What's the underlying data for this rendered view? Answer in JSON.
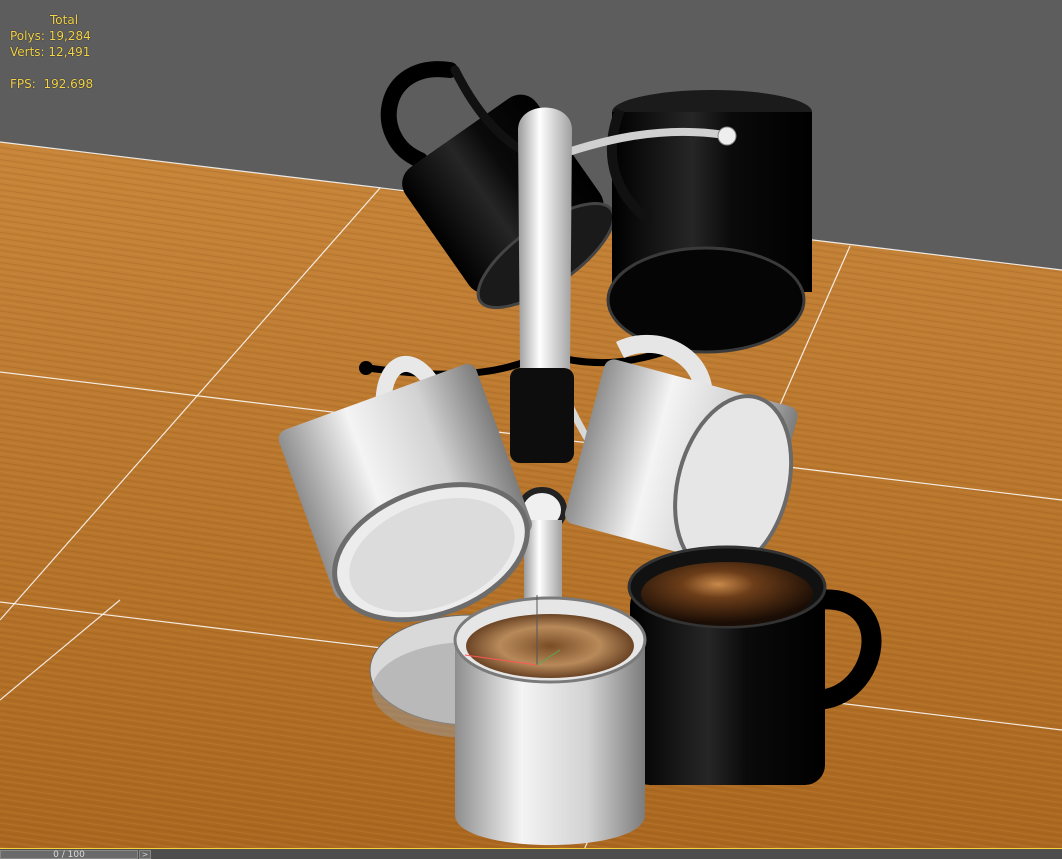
{
  "stats": {
    "title": "Total",
    "polys_label": "Polys:",
    "polys_value": "19,284",
    "verts_label": "Verts:",
    "verts_value": "12,491",
    "fps_label": "FPS:",
    "fps_value": "192.698"
  },
  "timeline": {
    "frame_readout": "0 / 100",
    "next_symbol": ">"
  },
  "colors": {
    "background": "#5d5d5d",
    "floor": "#b9772a",
    "grid_lines": "#ffffff",
    "stats_text": "#f5d54a",
    "timeline_accent": "#f3d23b"
  }
}
